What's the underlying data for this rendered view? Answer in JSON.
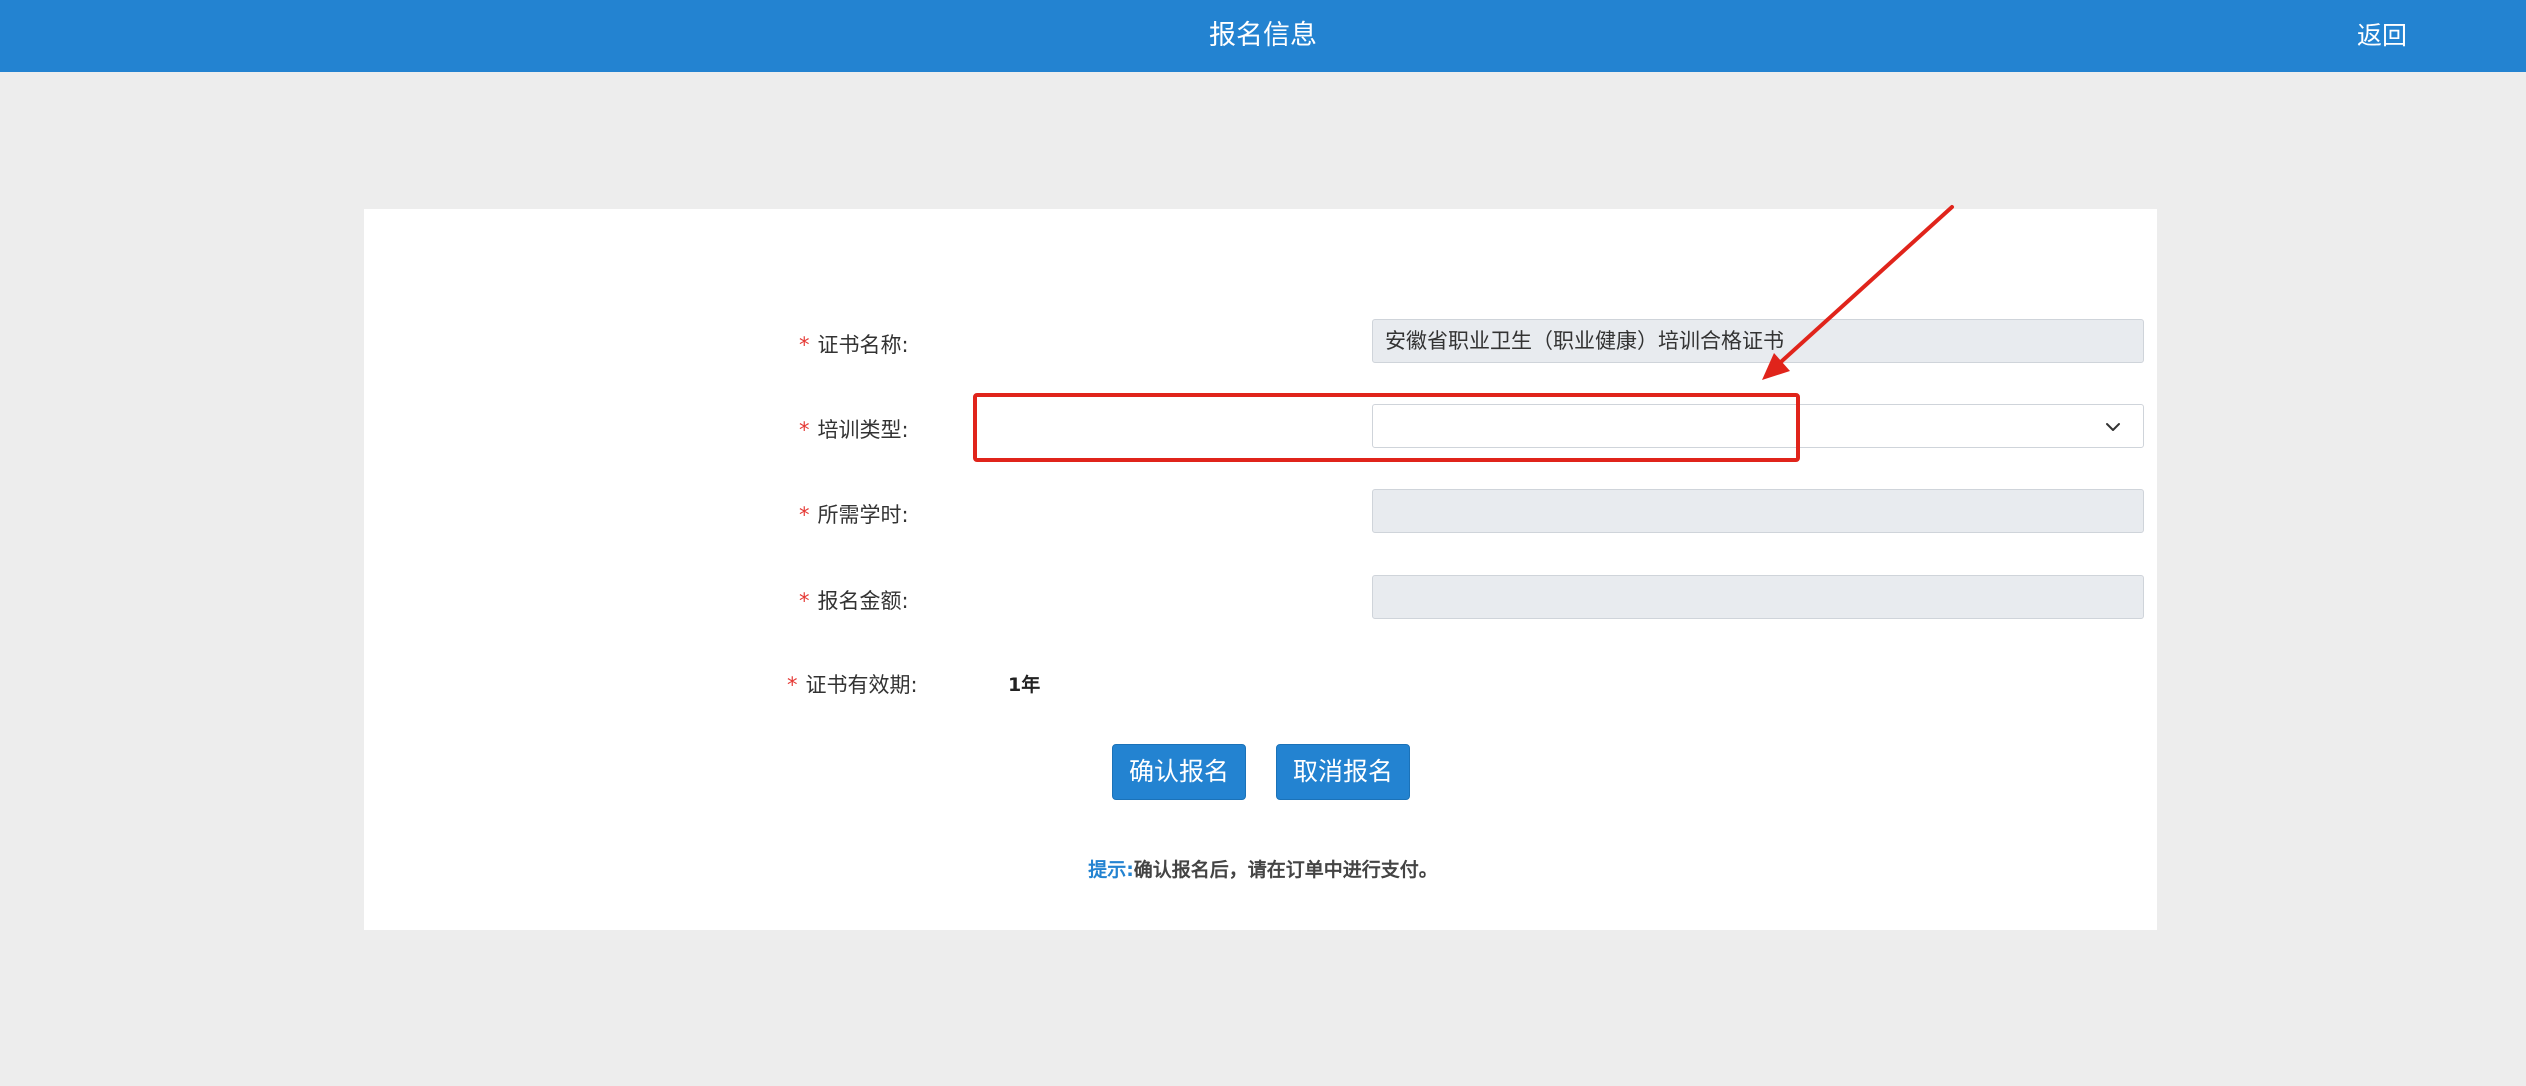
{
  "header": {
    "title": "报名信息",
    "back_label": "返回"
  },
  "form": {
    "required_mark": "*",
    "certificate_name": {
      "label": "证书名称:",
      "value": "安徽省职业卫生（职业健康）培训合格证书"
    },
    "training_type": {
      "label": "培训类型:",
      "value": "",
      "icon": "chevron-down-icon"
    },
    "required_hours": {
      "label": "所需学时:",
      "value": ""
    },
    "fee": {
      "label": "报名金额:",
      "value": ""
    },
    "validity": {
      "label": "证书有效期:",
      "value": "1年"
    }
  },
  "buttons": {
    "confirm_label": "确认报名",
    "cancel_label": "取消报名"
  },
  "hint": {
    "label": "提示:",
    "text": "确认报名后，请在订单中进行支付。"
  },
  "colors": {
    "header_bg": "#2383d1",
    "button_bg": "#2383d1",
    "required_mark": "#e53935",
    "annotation_red": "#e0241b",
    "page_bg": "#ededed"
  }
}
